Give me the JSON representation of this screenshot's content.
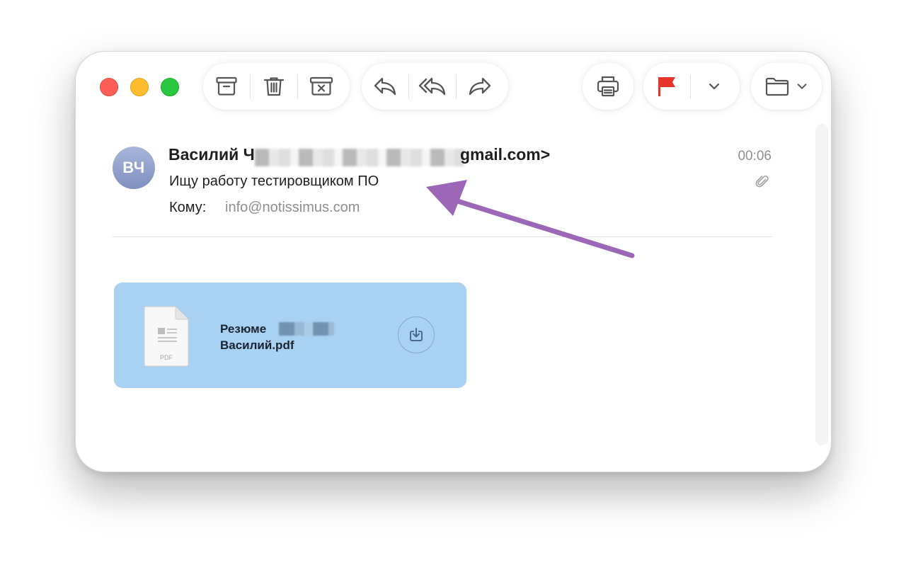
{
  "window": {
    "traffic_lights": [
      "close",
      "minimize",
      "zoom"
    ]
  },
  "toolbar": {
    "groups": [
      {
        "buttons": [
          {
            "icon": "archive-icon"
          },
          {
            "icon": "trash-icon"
          },
          {
            "icon": "junk-icon"
          }
        ]
      },
      {
        "buttons": [
          {
            "icon": "reply-icon"
          },
          {
            "icon": "reply-all-icon"
          },
          {
            "icon": "forward-icon"
          }
        ]
      },
      {
        "buttons": [
          {
            "icon": "print-icon"
          }
        ]
      },
      {
        "buttons": [
          {
            "icon": "flag-icon"
          },
          {
            "icon": "chevron-down-icon"
          }
        ]
      },
      {
        "buttons": [
          {
            "icon": "folder-icon"
          },
          {
            "icon": "chevron-down-icon"
          }
        ]
      }
    ],
    "flag_color": "#e8332b"
  },
  "message": {
    "avatar_initials": "ВЧ",
    "sender_name": "Василий Ч",
    "sender_email_visible": "gmail.com>",
    "time": "00:06",
    "subject": "Ищу работу тестировщиком ПО",
    "to_label": "Кому:",
    "to_value": "info@notissimus.com",
    "has_attachment": true
  },
  "attachment": {
    "file_type_label": "PDF",
    "name_line1": "Резюме",
    "name_line2": "Василий.pdf",
    "background": "#a9d1f1"
  },
  "annotation": {
    "arrow_color": "#9b67b6"
  }
}
